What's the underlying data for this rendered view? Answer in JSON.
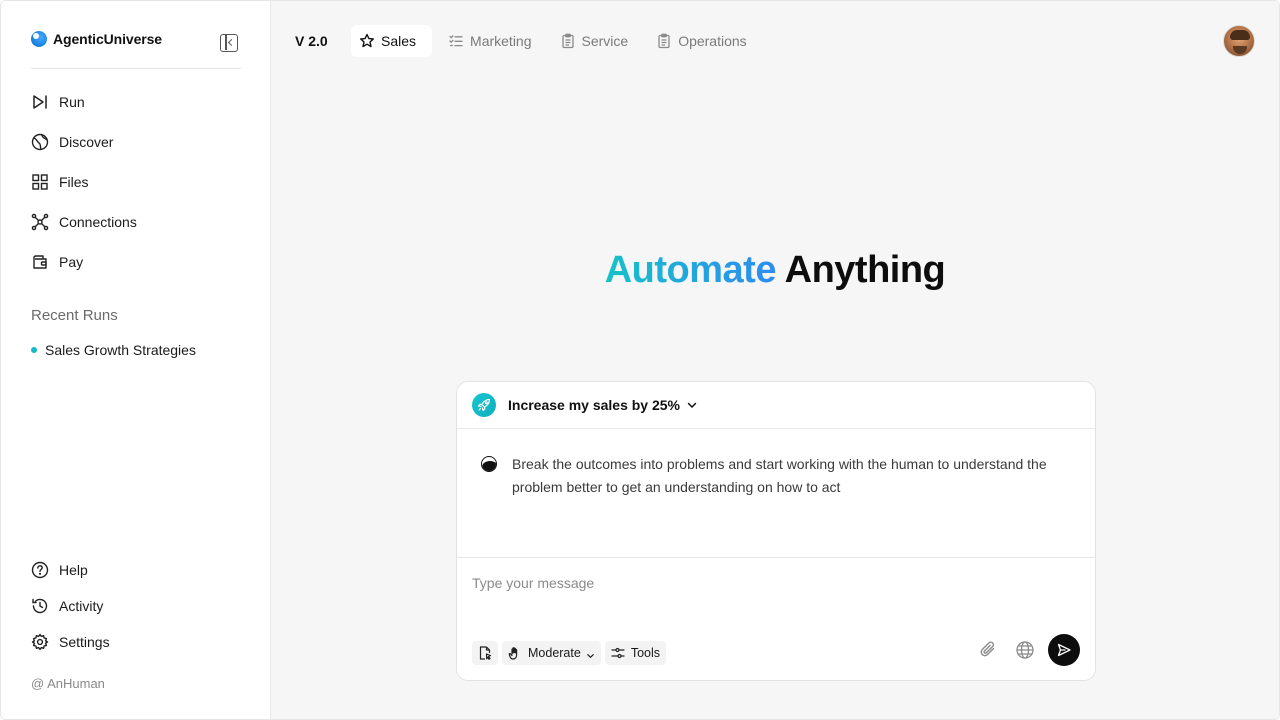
{
  "sidebar": {
    "brand": "AgenticUniverse",
    "nav": [
      {
        "label": "Run",
        "icon": "run-icon"
      },
      {
        "label": "Discover",
        "icon": "globe-icon"
      },
      {
        "label": "Files",
        "icon": "grid-icon"
      },
      {
        "label": "Connections",
        "icon": "network-icon"
      },
      {
        "label": "Pay",
        "icon": "wallet-icon"
      }
    ],
    "recent_title": "Recent Runs",
    "recent_runs": [
      {
        "label": "Sales Growth Strategies",
        "dot_color": "#18b6c9"
      }
    ],
    "bottom_nav": [
      {
        "label": "Help",
        "icon": "help-icon"
      },
      {
        "label": "Activity",
        "icon": "history-icon"
      },
      {
        "label": "Settings",
        "icon": "gear-icon"
      }
    ],
    "user_handle": "@ AnHuman"
  },
  "topbar": {
    "version": "V 2.0",
    "tabs": [
      {
        "label": "Sales",
        "icon": "star-icon",
        "active": true
      },
      {
        "label": "Marketing",
        "icon": "checklist-icon",
        "active": false
      },
      {
        "label": "Service",
        "icon": "clipboard-icon",
        "active": false
      },
      {
        "label": "Operations",
        "icon": "clipboard-icon",
        "active": false
      }
    ]
  },
  "hero": {
    "accent": "Automate",
    "rest": "Anything"
  },
  "chat": {
    "goal": "Increase my sales by 25%",
    "agent_message": "Break the outcomes into problems and start working with the human to understand the problem better to get an understanding on how to act",
    "input_placeholder": "Type your message",
    "mode_label": "Moderate",
    "tools_label": "Tools"
  },
  "colors": {
    "accent_start": "#16c2c9",
    "accent_end": "#2e8cf0",
    "send_button": "#0d0d0d"
  }
}
